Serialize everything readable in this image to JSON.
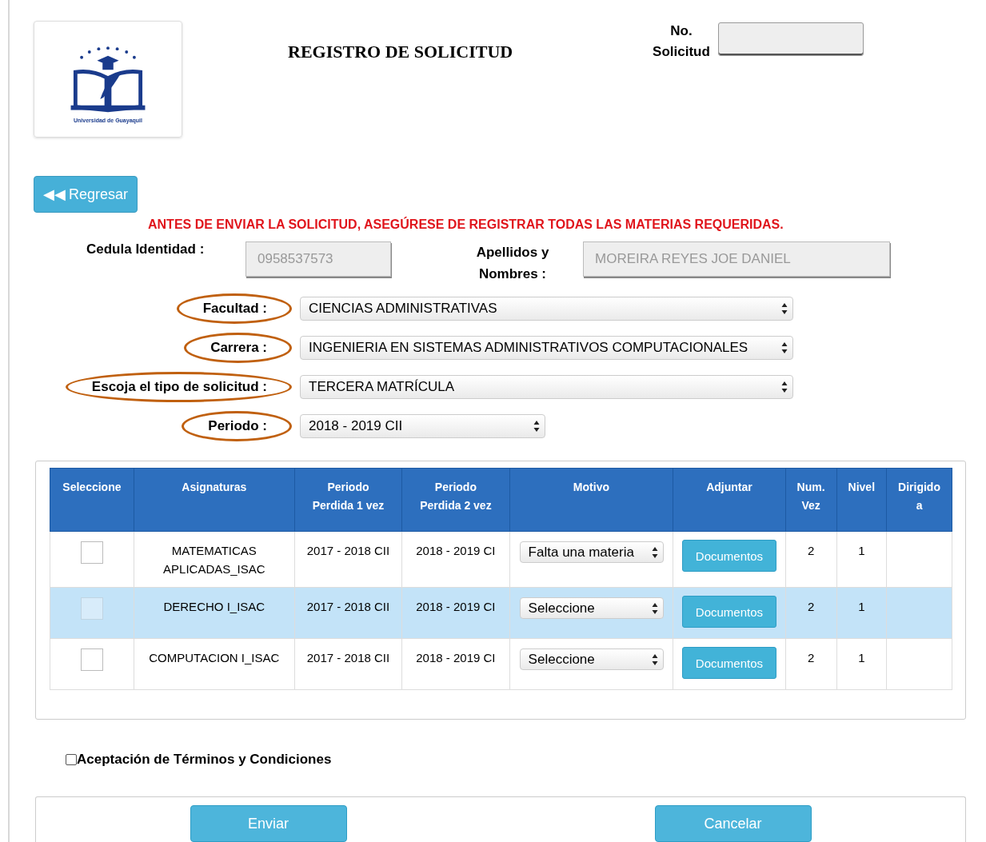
{
  "logo": {
    "caption": "Universidad de Guayaquil"
  },
  "title": "REGISTRO DE SOLICITUD",
  "request_number": {
    "label": "No. Solicitud"
  },
  "back_button": {
    "icon": "◀◀",
    "label": "Regresar"
  },
  "warning": "ANTES DE ENVIAR LA SOLICITUD, ASEGÚRESE DE REGISTRAR TODAS LAS MATERIAS REQUERIDAS.",
  "identity": [
    {
      "label": "Cedula Identidad :",
      "value": "0958537573"
    },
    {
      "label": "Apellidos y Nombres :",
      "value": "MOREIRA  REYES JOE  DANIEL"
    }
  ],
  "selects": [
    {
      "label": "Facultad :",
      "value": "CIENCIAS ADMINISTRATIVAS",
      "circled": true,
      "wide": true
    },
    {
      "label": "Carrera :",
      "value": "INGENIERIA EN SISTEMAS ADMINISTRATIVOS COMPUTACIONALES",
      "circled": true,
      "wide": true
    },
    {
      "label": "Escoja el tipo de solicitud  :",
      "value": "TERCERA MATRÍCULA",
      "circled": true,
      "wide": true
    },
    {
      "label": "Periodo :",
      "value": "2018 - 2019 CII",
      "circled": true,
      "wide": false
    }
  ],
  "table": {
    "columns": [
      "Seleccione",
      "Asignaturas",
      "Periodo Perdida 1 vez",
      "Periodo Perdida 2 vez",
      "Motivo",
      "Adjuntar",
      "Num. Vez",
      "Nivel",
      "Dirigido a"
    ],
    "rows": [
      {
        "selected": false,
        "checked": false,
        "disabled": false,
        "subject": "MATEMATICAS APLICADAS_ISAC",
        "period_1": "2017 - 2018 CII",
        "period_2": "2018 - 2019 CI",
        "reason": "Falta una materia",
        "attach": "Documentos",
        "times": "2",
        "level_text": "1"
      },
      {
        "selected": true,
        "checked": false,
        "disabled": true,
        "subject": "DERECHO I_ISAC",
        "period_1": "2017 - 2018 CII",
        "period_2": "2018 - 2019 CI",
        "reason": "Seleccione",
        "attach": "Documentos",
        "times": "2",
        "level_text": "1"
      },
      {
        "selected": false,
        "checked": false,
        "disabled": false,
        "subject": "COMPUTACION I_ISAC",
        "period_1": "2017 - 2018 CII",
        "period_2": "2018 - 2019 CI",
        "reason": "Seleccione",
        "attach": "Documentos",
        "times": "2",
        "level_text": "1"
      }
    ]
  },
  "terms": {
    "label": "Aceptación de Términos y Condiciones",
    "checked": false
  },
  "buttons": [
    "Enviar",
    "Cancelar"
  ]
}
